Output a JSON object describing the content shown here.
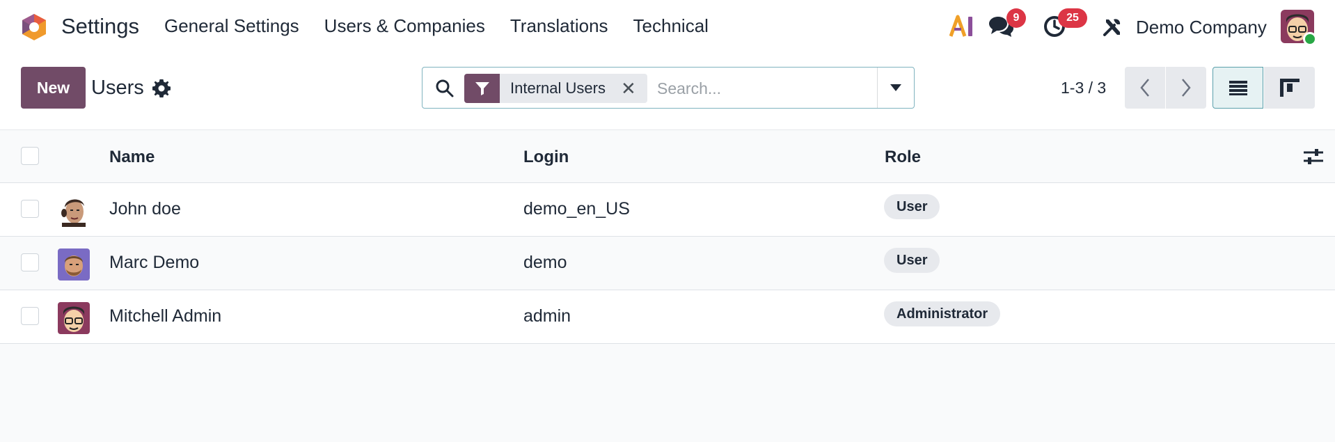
{
  "navbar": {
    "app_name": "Settings",
    "menu": [
      "General Settings",
      "Users & Companies",
      "Translations",
      "Technical"
    ],
    "messages_count": "9",
    "activities_count": "25",
    "company_name": "Demo Company",
    "colors": {
      "brand": "#714b67",
      "badge": "#dc3545",
      "online": "#28a745"
    }
  },
  "control_panel": {
    "new_label": "New",
    "title": "Users",
    "search": {
      "facet_label": "Internal Users",
      "facet_close": "✕",
      "placeholder": "Search..."
    },
    "pager_value": "1-3 / 3"
  },
  "table": {
    "columns": {
      "name": "Name",
      "login": "Login",
      "role": "Role"
    },
    "rows": [
      {
        "name": "John doe",
        "login": "demo_en_US",
        "role": "User"
      },
      {
        "name": "Marc Demo",
        "login": "demo",
        "role": "User"
      },
      {
        "name": "Mitchell Admin",
        "login": "admin",
        "role": "Administrator"
      }
    ]
  }
}
